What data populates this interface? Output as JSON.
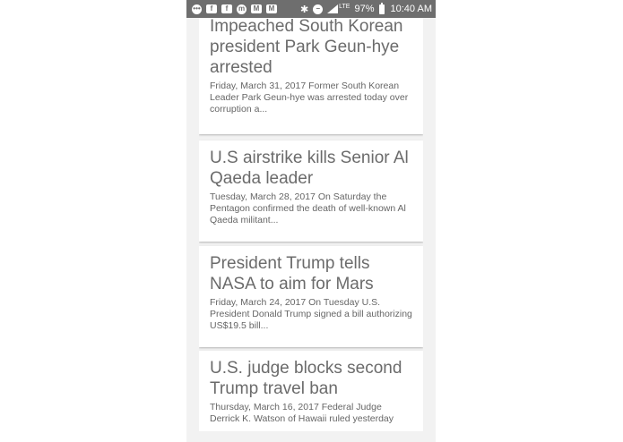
{
  "status_bar": {
    "icons": [
      "message-icon",
      "facebook-icon",
      "facebook-icon",
      "messenger-icon",
      "gmail-icon",
      "gmail-icon"
    ],
    "notification_glyphs": [
      "•••",
      "f",
      "f",
      "m",
      "M",
      "M"
    ],
    "bluetooth_glyph": "✱",
    "dnd_glyph": "−",
    "network": "LTE",
    "battery": "97%",
    "time": "10:40 AM"
  },
  "articles": [
    {
      "title": "Impeached South Korean president Park Geun-hye arrested",
      "description": "Friday, March 31, 2017 Former South Korean Leader Park Geun-hye was arrested today over corruption a..."
    },
    {
      "title": "U.S airstrike kills Senior Al Qaeda leader",
      "description": "Tuesday, March 28, 2017 On Saturday the Pentagon confirmed the death of well-known Al Qaeda militant..."
    },
    {
      "title": "President Trump tells NASA to aim for Mars",
      "description": "Friday, March 24, 2017 On Tuesday U.S. President Donald Trump signed a bill authorizing US$19.5 bill..."
    },
    {
      "title": "U.S. judge blocks second Trump travel ban",
      "description": "Thursday, March 16, 2017 Federal Judge Derrick K. Watson of Hawaii ruled yesterday"
    }
  ],
  "colors": {
    "status_bar": "#6e6e6e",
    "background": "#f2f2f2",
    "card": "#ffffff",
    "title_text": "#6b6b6b",
    "body_text": "#666666"
  }
}
